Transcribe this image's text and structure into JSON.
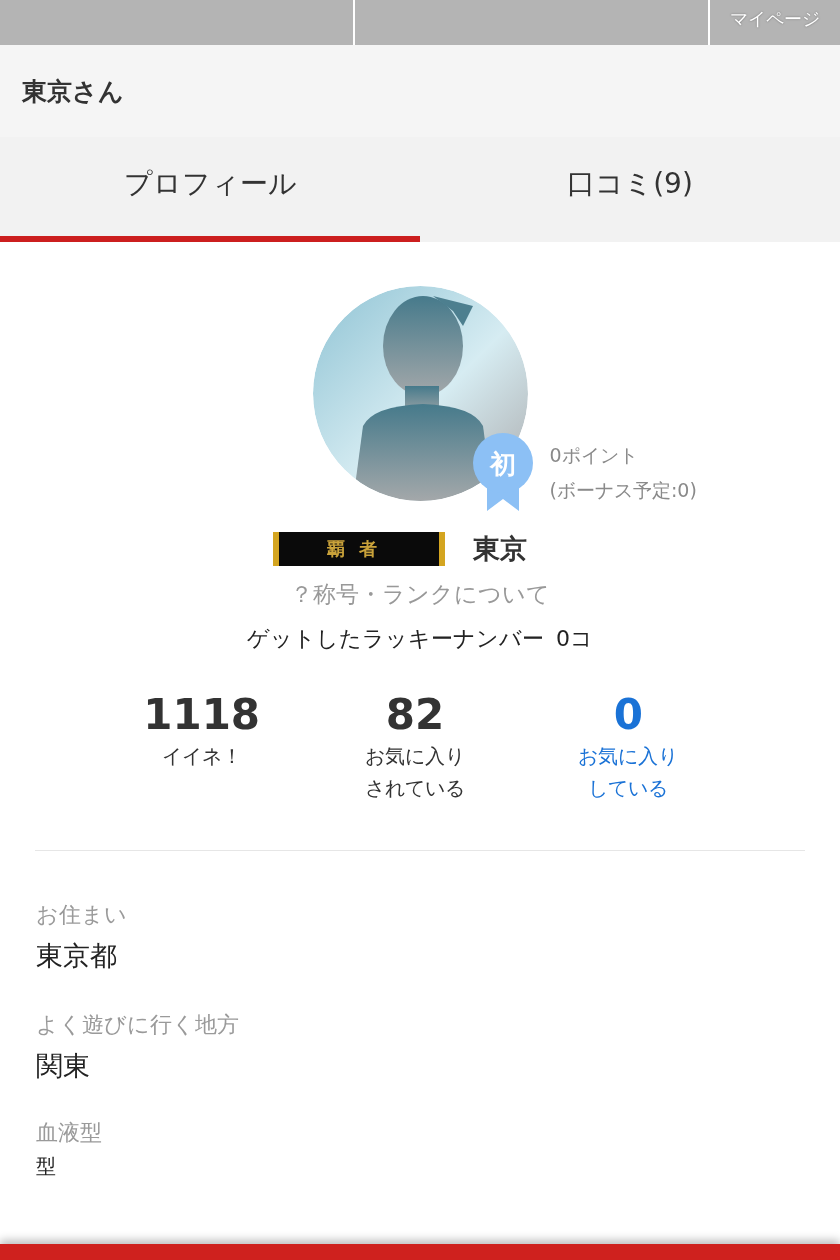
{
  "top_nav": {
    "items": [
      {
        "kind": "blank"
      },
      {
        "kind": "blank"
      },
      {
        "kind": "label",
        "label": "マイページ"
      }
    ]
  },
  "header": {
    "title": "東京さん"
  },
  "tabs": [
    {
      "label": "プロフィール",
      "selected": true
    },
    {
      "label": "口コミ(9)",
      "selected": false
    }
  ],
  "profile": {
    "badge": "初",
    "points": "0ポイント",
    "bonus": "(ボーナス予定:0)",
    "rank_title": "覇者",
    "name": "東京",
    "rank_link": "？称号・ランクについて",
    "lucky_label": "ゲットしたラッキーナンバー",
    "lucky_count": "0コ"
  },
  "stats": [
    {
      "kind": "count",
      "value": "1118",
      "label": "イイネ！"
    },
    {
      "kind": "count",
      "value": "82",
      "label": "お気に入りされている"
    },
    {
      "kind": "link",
      "value": "0",
      "label": "お気に入りしている"
    }
  ],
  "fields": [
    {
      "label": "お住まい",
      "value": "東京都"
    },
    {
      "label": "よく遊びに行く地方",
      "value": "関東"
    },
    {
      "label": "血液型",
      "value": "型"
    }
  ]
}
